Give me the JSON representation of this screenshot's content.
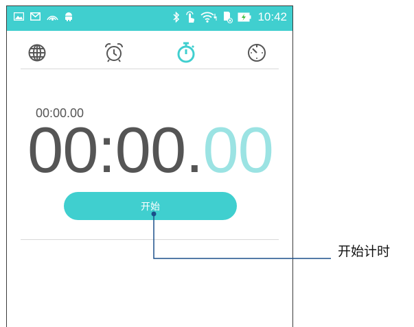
{
  "statusbar": {
    "time": "10:42",
    "icons_left": [
      "gallery-icon",
      "mail-icon",
      "hotspot-icon",
      "android-icon"
    ],
    "icons_right": [
      "bluetooth-icon",
      "touch-icon",
      "wifi-icon",
      "sdcard-icon",
      "battery-charging-icon"
    ],
    "color": "#40cfcf"
  },
  "tabs": [
    {
      "name": "world-clock",
      "icon": "globe-icon",
      "active": false
    },
    {
      "name": "alarm",
      "icon": "alarm-clock-icon",
      "active": false
    },
    {
      "name": "stopwatch",
      "icon": "stopwatch-icon",
      "active": true
    },
    {
      "name": "timer",
      "icon": "timer-icon",
      "active": false
    }
  ],
  "stopwatch": {
    "lap_time": "00:00.00",
    "main": "00:00.",
    "hundredths": "00"
  },
  "start_button": {
    "label": "开始",
    "color": "#40cfcf"
  },
  "callout": {
    "label": "开始计时"
  },
  "colors": {
    "accent": "#40cfcf",
    "text": "#555555",
    "callout_line": "#1a4f8a"
  }
}
